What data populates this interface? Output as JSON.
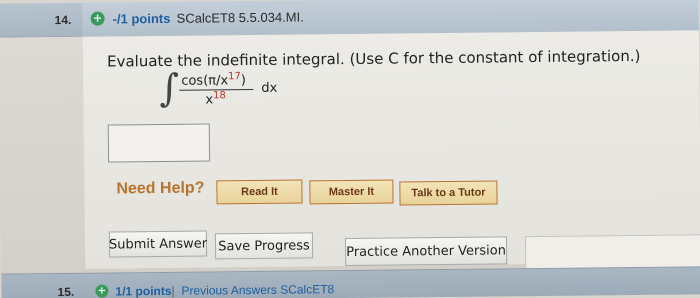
{
  "question": {
    "number": "14.",
    "icon": "plus-circle-icon",
    "points": "-/1 points",
    "code": "SCalcET8 5.5.034.MI.",
    "prompt": "Evaluate the indefinite integral. (Use C for the constant of integration.)",
    "integral": {
      "numerator_base": "cos(π/x",
      "numerator_exp": "17",
      "numerator_close": ")",
      "denominator_base": "x",
      "denominator_exp": "18",
      "dx": "dx"
    },
    "answer_value": ""
  },
  "help": {
    "label": "Need Help?",
    "read_it": "Read It",
    "master_it": "Master It",
    "talk_to_tutor": "Talk to a Tutor"
  },
  "actions": {
    "submit": "Submit Answer",
    "save": "Save Progress",
    "practice": "Practice Another Version"
  },
  "next_question": {
    "number": "15.",
    "icon": "plus-circle-icon",
    "points": "1/1 points",
    "separator": "|",
    "previous": "Previous Answers SCalcET8"
  },
  "colors": {
    "header_bar": "#b3c0cc",
    "points_blue": "#1f5fa0",
    "help_orange": "#b8742e",
    "plus_green": "#3a9a5c"
  }
}
